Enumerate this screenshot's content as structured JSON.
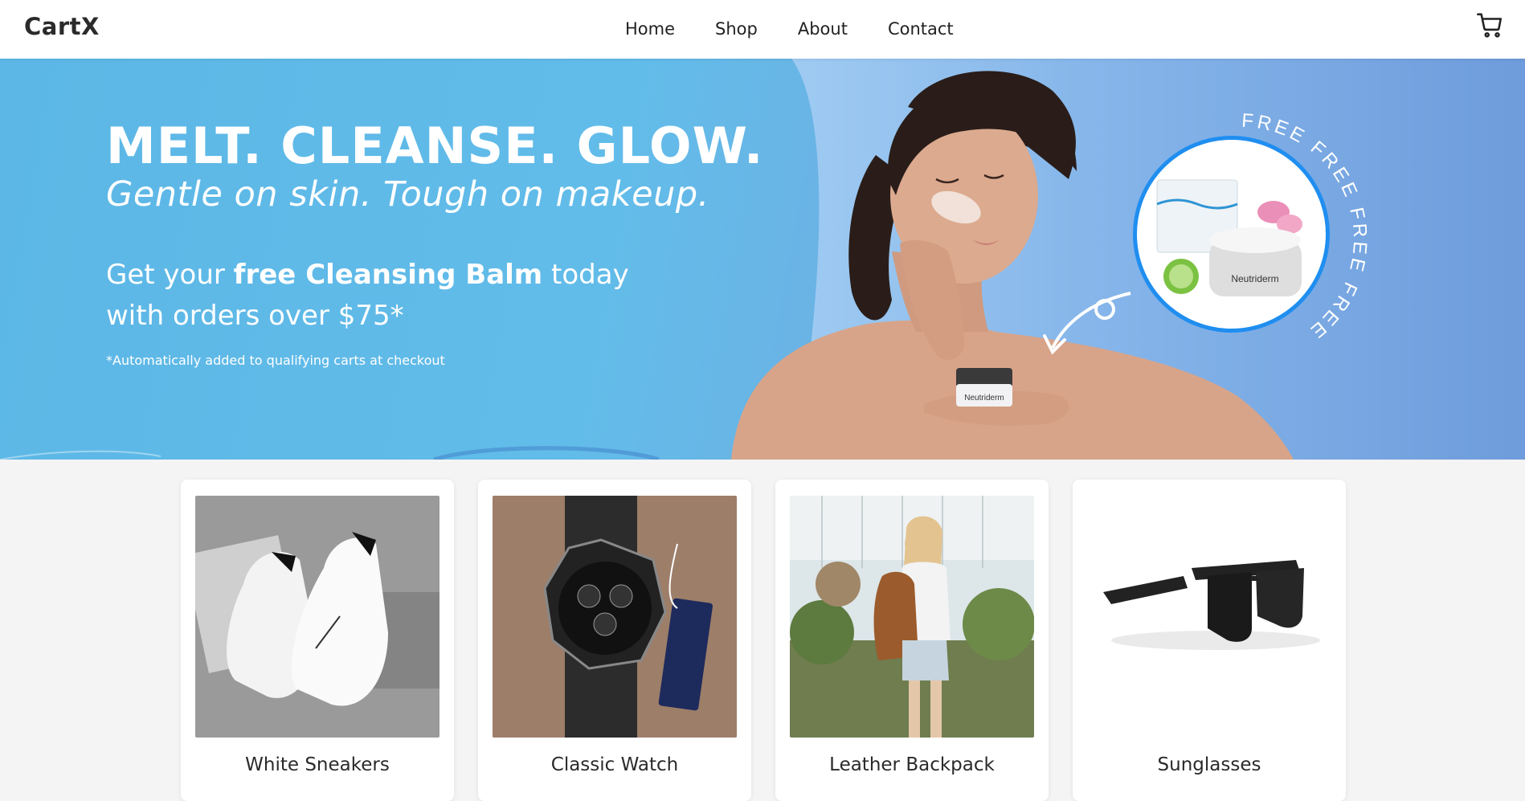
{
  "header": {
    "brand": "CartX",
    "nav": [
      "Home",
      "Shop",
      "About",
      "Contact"
    ],
    "cart_icon": "shopping-cart-icon"
  },
  "hero": {
    "headline": "MELT. CLEANSE. GLOW.",
    "subhead": "Gentle on skin. Tough on makeup.",
    "offer_prefix": "Get your ",
    "offer_bold": "free Cleansing Balm",
    "offer_suffix": " today",
    "offer_line2": "with orders over $75*",
    "fineprint": "*Automatically added to qualifying carts at checkout",
    "product_brand": "Neutriderm",
    "badge_product_label": "Cleansing Balm",
    "free_ring_text": "FREE   FREE   FREE   FREE"
  },
  "products": [
    {
      "name": "White Sneakers",
      "icon": "sneaker-image"
    },
    {
      "name": "Classic Watch",
      "icon": "watch-image"
    },
    {
      "name": "Leather Backpack",
      "icon": "backpack-image"
    },
    {
      "name": "Sunglasses",
      "icon": "sunglasses-image"
    }
  ],
  "colors": {
    "hero_blue": "#5cb7e6",
    "badge_ring": "#1f8ef0"
  }
}
